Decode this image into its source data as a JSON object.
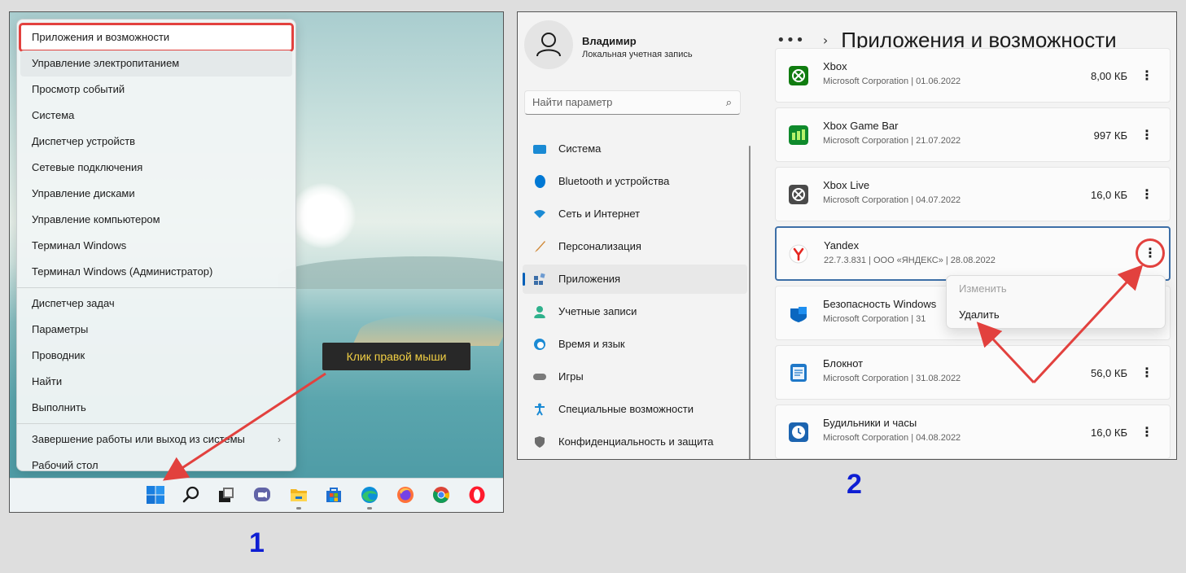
{
  "panel1": {
    "start_menu": {
      "items": [
        {
          "label": "Приложения и возможности"
        },
        {
          "label": "Управление электропитанием"
        },
        {
          "label": "Просмотр событий"
        },
        {
          "label": "Система"
        },
        {
          "label": "Диспетчер устройств"
        },
        {
          "label": "Сетевые подключения"
        },
        {
          "label": "Управление дисками"
        },
        {
          "label": "Управление компьютером"
        },
        {
          "label": "Терминал Windows"
        },
        {
          "label": "Терминал Windows (Администратор)"
        },
        {
          "label": "Диспетчер задач"
        },
        {
          "label": "Параметры"
        },
        {
          "label": "Проводник"
        },
        {
          "label": "Найти"
        },
        {
          "label": "Выполнить"
        },
        {
          "label": "Завершение работы или выход из системы"
        },
        {
          "label": "Рабочий стол"
        }
      ],
      "submenu_glyph": "›"
    },
    "callout": "Клик правой мыши",
    "label": "1",
    "taskbar_icons": [
      "windows-start-icon",
      "search-icon",
      "task-view-icon",
      "teams-chat-icon",
      "file-explorer-icon",
      "microsoft-store-icon",
      "edge-icon",
      "firefox-icon",
      "chrome-icon",
      "opera-icon"
    ]
  },
  "panel2": {
    "user": {
      "name": "Владимир",
      "account_type": "Локальная учетная запись"
    },
    "search": {
      "placeholder": "Найти параметр",
      "icon": "⌕"
    },
    "nav": [
      {
        "label": "Система",
        "icon": "system-icon",
        "color": "#1a8ad4"
      },
      {
        "label": "Bluetooth и устройства",
        "icon": "bluetooth-icon",
        "color": "#0078d4"
      },
      {
        "label": "Сеть и Интернет",
        "icon": "wifi-icon",
        "color": "#1a8ad4"
      },
      {
        "label": "Персонализация",
        "icon": "brush-icon",
        "color": "#d08a3a"
      },
      {
        "label": "Приложения",
        "icon": "apps-icon",
        "color": "#3b6ea8"
      },
      {
        "label": "Учетные записи",
        "icon": "accounts-icon",
        "color": "#2fb18c"
      },
      {
        "label": "Время и язык",
        "icon": "time-language-icon",
        "color": "#1a8ad4"
      },
      {
        "label": "Игры",
        "icon": "gaming-icon",
        "color": "#7a7a7a"
      },
      {
        "label": "Специальные возможности",
        "icon": "accessibility-icon",
        "color": "#1a8ad4"
      },
      {
        "label": "Конфиденциальность и защита",
        "icon": "shield-icon",
        "color": "#6d6d6d"
      }
    ],
    "breadcrumb": {
      "dots": "•••",
      "arrow": "›",
      "title": "Приложения и возможности"
    },
    "apps": [
      {
        "name": "Xbox",
        "meta": "Microsoft Corporation   |   01.06.2022",
        "size": "8,00 КБ",
        "icon": "xbox-icon",
        "color": "#107c10"
      },
      {
        "name": "Xbox Game Bar",
        "meta": "Microsoft Corporation   |   21.07.2022",
        "size": "997 КБ",
        "icon": "xbox-game-bar-icon",
        "color": "#0f8a2c"
      },
      {
        "name": "Xbox Live",
        "meta": "Microsoft Corporation   |   04.07.2022",
        "size": "16,0 КБ",
        "icon": "xbox-live-icon",
        "color": "#4a4a4a"
      },
      {
        "name": "Yandex",
        "meta": "22.7.3.831   |   ООО «ЯНДЕКС»   |   28.08.2022",
        "size": "",
        "icon": "yandex-browser-icon",
        "color": "#e52620"
      },
      {
        "name": "Безопасность Windows",
        "meta": "Microsoft Corporation   |   31",
        "size": "",
        "icon": "windows-security-icon",
        "color": "#0a67c0"
      },
      {
        "name": "Блокнот",
        "meta": "Microsoft Corporation   |   31.08.2022",
        "size": "56,0 КБ",
        "icon": "notepad-icon",
        "color": "#1f78c8"
      },
      {
        "name": "Будильники и часы",
        "meta": "Microsoft Corporation   |   04.08.2022",
        "size": "16,0 КБ",
        "icon": "alarms-clock-icon",
        "color": "#1c64b0"
      }
    ],
    "kebab": "⋮",
    "context_menu": {
      "change": "Изменить",
      "uninstall": "Удалить"
    },
    "label": "2"
  },
  "colors": {
    "annotation_red": "#e2413e",
    "label_blue": "#0e1ed3",
    "callout_text": "#f1cf44"
  }
}
